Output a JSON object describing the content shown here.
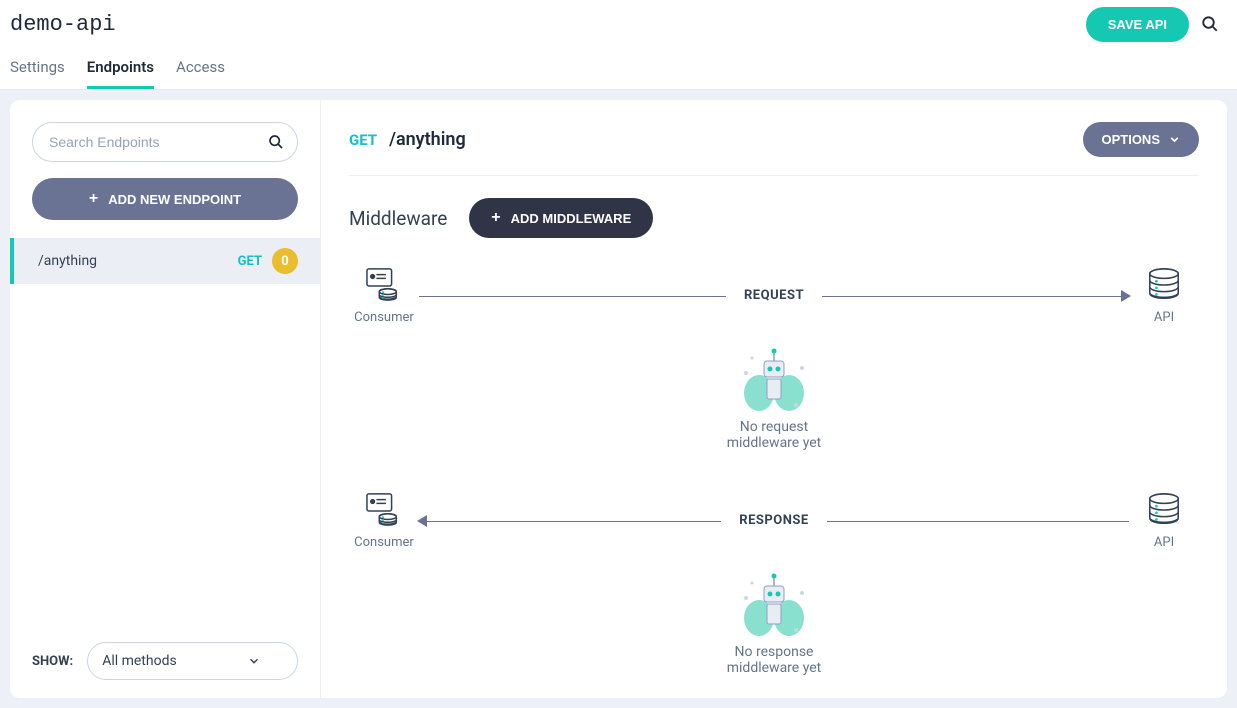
{
  "header": {
    "title": "demo-api",
    "save_label": "SAVE API"
  },
  "tabs": [
    {
      "label": "Settings",
      "active": false
    },
    {
      "label": "Endpoints",
      "active": true
    },
    {
      "label": "Access",
      "active": false
    }
  ],
  "sidebar": {
    "search_placeholder": "Search Endpoints",
    "add_new_label": "ADD NEW ENDPOINT",
    "endpoints": [
      {
        "path": "/anything",
        "method": "GET",
        "count": "0"
      }
    ],
    "show_label": "SHOW:",
    "method_filter": "All methods"
  },
  "main": {
    "method": "GET",
    "path": "/anything",
    "options_label": "OPTIONS",
    "middleware_label": "Middleware",
    "add_middleware_label": "ADD MIDDLEWARE",
    "request": {
      "left_label": "Consumer",
      "mid_label": "REQUEST",
      "right_label": "API",
      "empty_msg": "No request\nmiddleware yet"
    },
    "response": {
      "left_label": "Consumer",
      "mid_label": "RESPONSE",
      "right_label": "API",
      "empty_msg": "No response\nmiddleware yet"
    }
  }
}
